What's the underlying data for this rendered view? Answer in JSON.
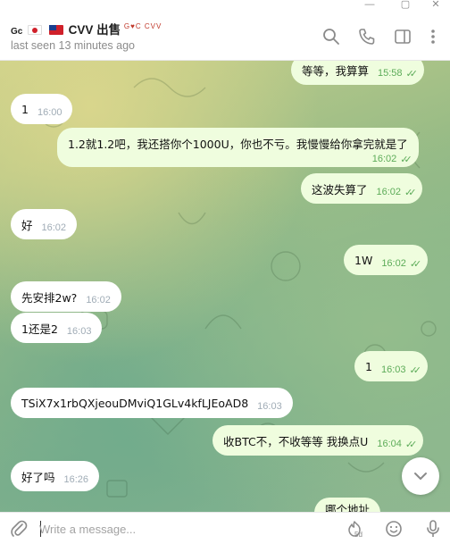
{
  "window": {
    "minimize_glyph": "—",
    "maximize_glyph": "▢",
    "close_glyph": "✕"
  },
  "header": {
    "title_prefix": "Gc",
    "flag_left": "japan-flag",
    "flag_right": "taiwan-flag",
    "title": "CVV 出售",
    "title_deco": "G♥C CVV",
    "subtitle": "last seen 13 minutes ago",
    "icons": [
      "search-icon",
      "phone-icon",
      "sidebar-icon",
      "more-icon"
    ]
  },
  "messages": [
    {
      "dir": "out",
      "text": "等等，我算算",
      "time": "15:58",
      "read": true
    },
    {
      "dir": "in",
      "text": "1",
      "time": "16:00"
    },
    {
      "dir": "out",
      "text": "1.2就1.2吧，我还搭你个1000U，你也不亏。我慢慢给你拿完就是了",
      "time": "16:02",
      "read": true
    },
    {
      "dir": "out",
      "text": "这波失算了",
      "time": "16:02",
      "read": true
    },
    {
      "dir": "in",
      "text": "好",
      "time": "16:02"
    },
    {
      "dir": "out",
      "text": "1W",
      "time": "16:02",
      "read": true
    },
    {
      "dir": "in",
      "text": "先安排2w?",
      "time": "16:02"
    },
    {
      "dir": "in",
      "text": "1还是2",
      "time": "16:03"
    },
    {
      "dir": "out",
      "text": "1",
      "time": "16:03",
      "read": true
    },
    {
      "dir": "in",
      "text": "TSiX7x1rbQXjeouDMviQ1GLv4kfLJEoAD8",
      "time": "16:03"
    },
    {
      "dir": "out",
      "text": "收BTC不，不收等等 我换点U",
      "time": "16:04",
      "read": true
    },
    {
      "dir": "in",
      "text": "好了吗",
      "time": "16:26"
    },
    {
      "dir": "out",
      "text": "哪个地址",
      "time": "",
      "read": false
    }
  ],
  "composer": {
    "placeholder": "Write a message...",
    "emoji_badge": "5d",
    "icons": [
      "attach-icon",
      "sticker-icon",
      "emoji-icon",
      "microphone-icon"
    ]
  },
  "colors": {
    "incoming_bubble": "#ffffff",
    "outgoing_bubble": "#effdde",
    "outgoing_time": "#5dac59",
    "incoming_time": "#a0acb6"
  }
}
